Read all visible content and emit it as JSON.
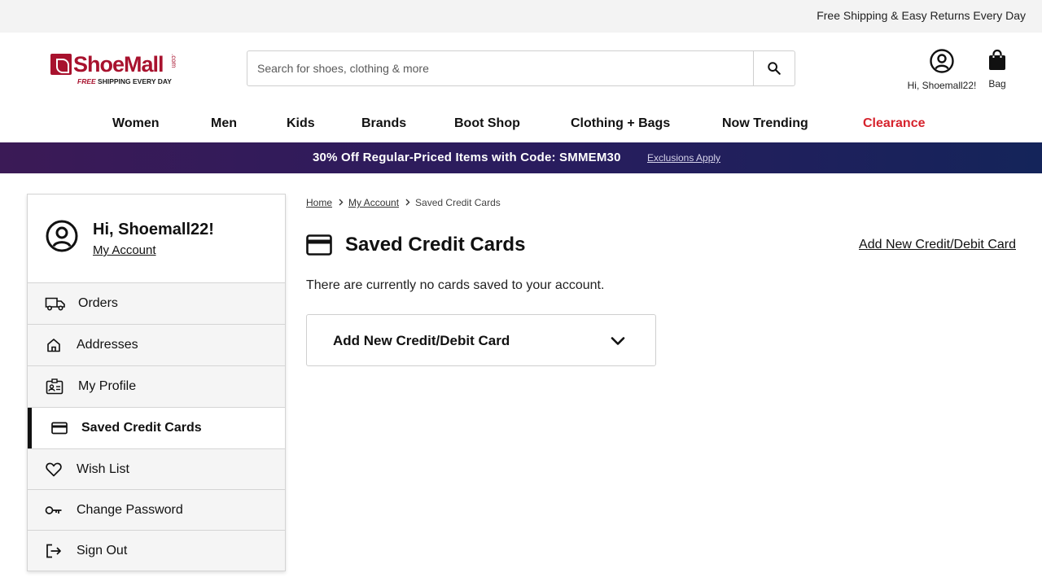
{
  "topbar": {
    "message": "Free Shipping & Easy Returns Every Day"
  },
  "logo": {
    "name": "ShoeMall",
    "dotcom": ".com",
    "tag_free": "FREE",
    "tag_rest": " SHIPPING EVERY DAY"
  },
  "search": {
    "placeholder": "Search for shoes, clothing & more",
    "icon": "search-icon"
  },
  "account": {
    "label": "Hi, Shoemall22!",
    "icon": "user-circle-icon"
  },
  "bag": {
    "label": "Bag",
    "icon": "shopping-bag-icon"
  },
  "nav": {
    "items": [
      {
        "label": "Women"
      },
      {
        "label": "Men"
      },
      {
        "label": "Kids"
      },
      {
        "label": "Brands"
      },
      {
        "label": "Boot Shop"
      },
      {
        "label": "Clothing + Bags"
      },
      {
        "label": "Now Trending"
      },
      {
        "label": "Clearance",
        "color": "#d6232d"
      }
    ]
  },
  "promo": {
    "text": "30% Off Regular-Priced Items with Code: SMMEM30",
    "link": "Exclusions Apply"
  },
  "sidebar": {
    "greeting": "Hi, Shoemall22!",
    "account_link": "My Account",
    "items": [
      {
        "label": "Orders",
        "icon": "truck-icon"
      },
      {
        "label": "Addresses",
        "icon": "home-icon"
      },
      {
        "label": "My Profile",
        "icon": "id-card-icon"
      },
      {
        "label": "Saved Credit Cards",
        "icon": "credit-card-icon",
        "active": true
      },
      {
        "label": "Wish List",
        "icon": "heart-icon"
      },
      {
        "label": "Change Password",
        "icon": "key-icon"
      },
      {
        "label": "Sign Out",
        "icon": "sign-out-icon"
      }
    ]
  },
  "breadcrumb": {
    "home": "Home",
    "account": "My Account",
    "current": "Saved Credit Cards"
  },
  "main": {
    "title": "Saved Credit Cards",
    "add_link": "Add New Credit/Debit Card",
    "empty_message": "There are currently no cards saved to your account.",
    "accordion_label": "Add New Credit/Debit Card"
  }
}
